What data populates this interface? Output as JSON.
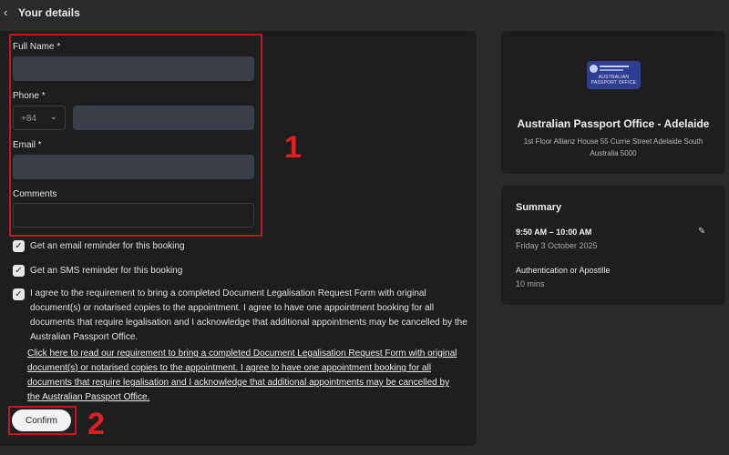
{
  "header": {
    "back_icon": "chevron-left-icon",
    "title": "Your details"
  },
  "form": {
    "full_name": {
      "label": "Full Name",
      "required": "*",
      "value": ""
    },
    "phone": {
      "label": "Phone",
      "required": "*",
      "country_code": "+84",
      "value": ""
    },
    "email": {
      "label": "Email",
      "required": "*",
      "value": ""
    },
    "comments": {
      "label": "Comments",
      "value": ""
    },
    "email_reminder": {
      "label": "Get an email reminder for this booking",
      "checked": true
    },
    "sms_reminder": {
      "label": "Get an SMS reminder for this booking",
      "checked": true
    },
    "agreement": {
      "label": "I agree to the requirement to bring a completed Document Legalisation Request Form with original document(s) or notarised copies to the appointment. I agree to have one appointment booking for all documents that require legalisation and I acknowledge that additional appointments may be cancelled by the Australian Passport Office.",
      "checked": true
    },
    "agreement_link": "Click here to read our requirement to bring a completed Document Legalisation Request Form with original document(s) or notarised copies to the appointment. I agree to have one appointment booking for all documents that require legalisation and I acknowledge that additional appointments may be cancelled by the Australian Passport Office.",
    "confirm_label": "Confirm",
    "check_mark": "✓"
  },
  "annotations": {
    "marker_1": "1",
    "marker_2": "2",
    "highlight_color": "#c8141c"
  },
  "office": {
    "logo_line1": "AUSTRALIAN",
    "logo_line2": "PASSPORT OFFICE",
    "name": "Australian Passport Office - Adelaide",
    "address": "1st Floor Allianz House 55 Currie Street Adelaide South Australia 5000"
  },
  "summary": {
    "title": "Summary",
    "time": "9:50 AM – 10:00 AM",
    "date": "Friday 3 October 2025",
    "edit_icon": "pencil-icon",
    "service": "Authentication or Apostille",
    "duration": "10 mins"
  }
}
